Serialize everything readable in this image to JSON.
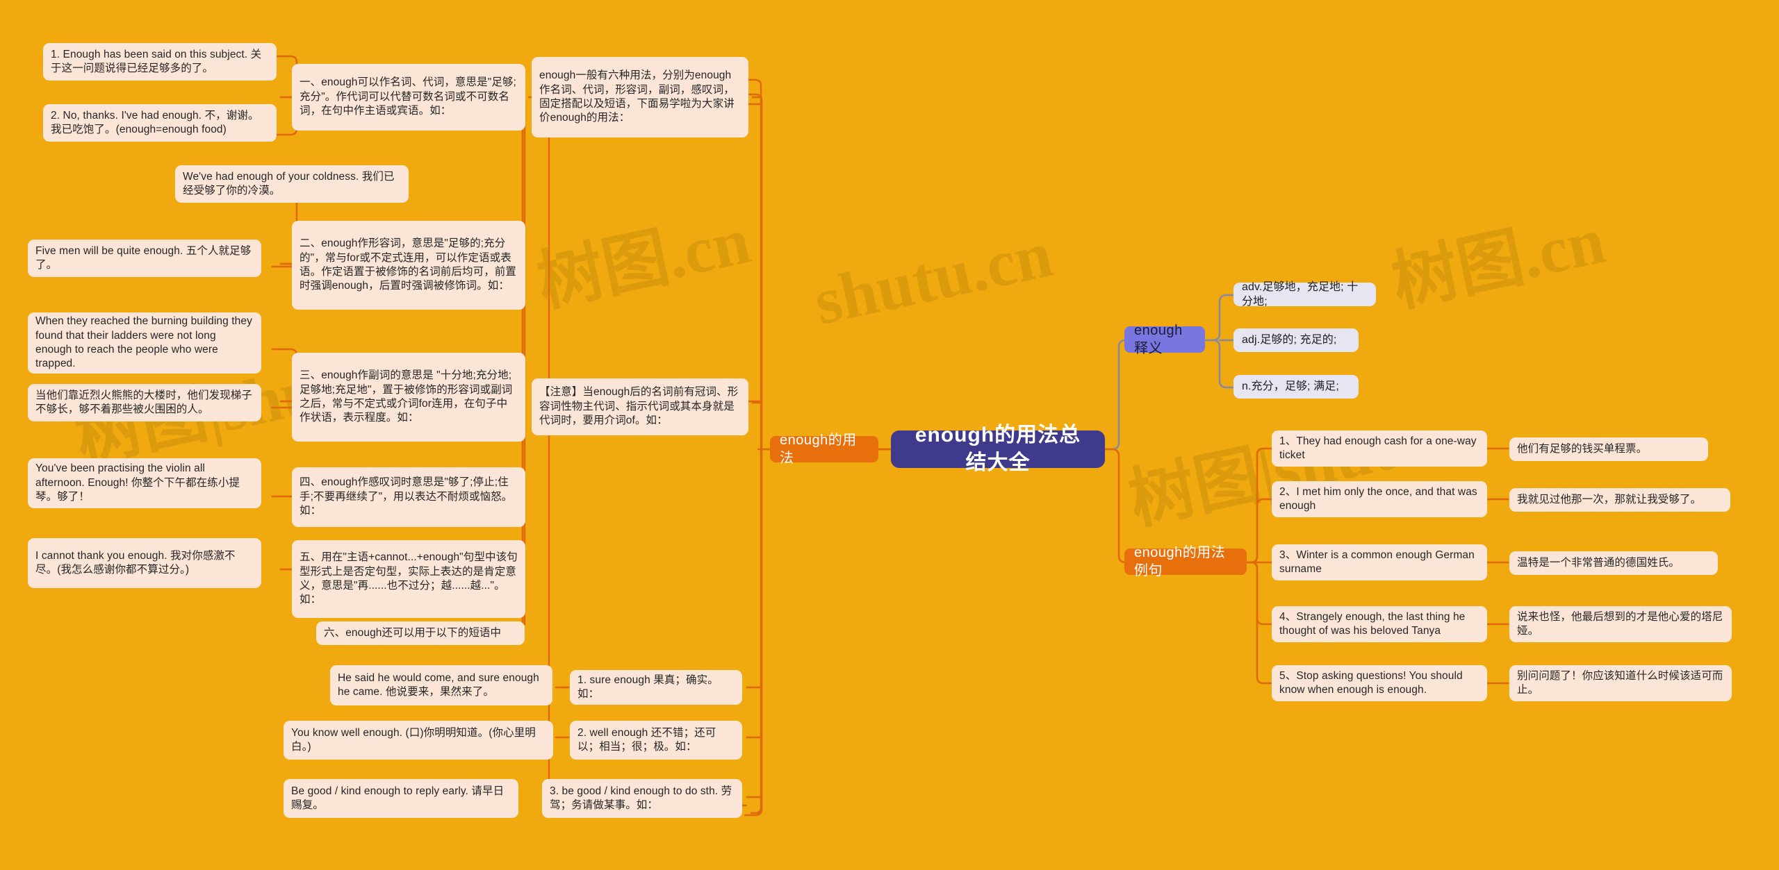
{
  "root": {
    "label": "enough的用法总结大全"
  },
  "watermarks": [
    "树图.cn",
    "shutu.cn",
    "树图.cn",
    "树图|shu",
    "树图|shutu"
  ],
  "branches": {
    "usage": {
      "label": "enough的用法"
    },
    "meaning": {
      "label": "enough释义"
    },
    "examples": {
      "label": "enough的用法例句"
    }
  },
  "intro": {
    "text": "enough一般有六种用法，分别为enough作名词、代词，形容词，副词，感叹词，固定搭配以及短语，下面易学啦为大家讲价enough的用法："
  },
  "note": {
    "text": "【注意】当enough后的名词前有冠词、形容词性物主代词、指示代词或其本身就是代词时，要用介词of。如："
  },
  "rules": [
    {
      "id": "rule1",
      "text": "一、enough可以作名词、代词，意思是\"足够;充分\"。作代词可以代替可数名词或不可数名词，在句中作主语或宾语。如："
    },
    {
      "id": "rule2",
      "text": "二、enough作形容词，意思是\"足够的;充分的\"，常与for或不定式连用，可以作定语或表语。作定语置于被修饰的名词前后均可，前置时强调enough，后置时强调被修饰词。如："
    },
    {
      "id": "rule3",
      "text": "三、enough作副词的意思是 \"十分地;充分地;足够地;充足地\"，置于被修饰的形容词或副词之后，常与不定式或介词for连用，在句子中作状语，表示程度。如："
    },
    {
      "id": "rule4",
      "text": "四、enough作感叹词时意思是\"够了;停止;住手;不要再继续了\"，用以表达不耐烦或恼怒。如："
    },
    {
      "id": "rule5",
      "text": "五、用在\"主语+cannot...+enough\"句型中该句型形式上是否定句型，实际上表达的是肯定意义，意思是\"再......也不过分；越......越...\"。如："
    },
    {
      "id": "rule6",
      "text": "六、enough还可以用于以下的短语中"
    }
  ],
  "rule1_examples": [
    {
      "text": "1. Enough has been said on this subject. 关于这一问题说得已经足够多的了。"
    },
    {
      "text": "2. No, thanks. I've had enough. 不，谢谢。我已吃饱了。(enough=enough food)"
    }
  ],
  "rule2_examples": [
    {
      "text": "We've had enough of your coldness. 我们已经受够了你的冷漠。"
    },
    {
      "text": "Five men will be quite enough. 五个人就足够了。"
    }
  ],
  "rule3_examples": [
    {
      "text": "When they reached the burning building they found that their ladders were not long enough to reach the people who were trapped."
    },
    {
      "text": "当他们靠近烈火熊熊的大楼时，他们发现梯子不够长，够不着那些被火围困的人。"
    }
  ],
  "rule4_examples": [
    {
      "text": "You've been practising the violin all afternoon. Enough! 你整个下午都在练小提琴。够了！"
    }
  ],
  "rule5_examples": [
    {
      "text": "I cannot thank you enough. 我对你感激不尽。(我怎么感谢你都不算过分。)"
    }
  ],
  "phrases": [
    {
      "label": "1. sure enough 果真；确实。如：",
      "example": "He said he would come, and sure enough he came. 他说要来，果然来了。"
    },
    {
      "label": "2. well enough 还不错；还可以；相当；很；极。如：",
      "example": "You know well enough. (口)你明明知道。(你心里明白。)"
    },
    {
      "label": "3. be good / kind enough to do sth. 劳驾；务请做某事。如：",
      "example": "Be good / kind enough to reply early. 请早日赐复。"
    }
  ],
  "meanings": [
    {
      "text": "adv.足够地，充足地; 十分地;"
    },
    {
      "text": "adj.足够的; 充足的;"
    },
    {
      "text": "n.充分，足够; 满足;"
    }
  ],
  "examples": [
    {
      "en": "1、They had enough cash for a one-way ticket",
      "zh": "他们有足够的钱买单程票。"
    },
    {
      "en": "2、I met him only the once, and that was enough",
      "zh": "我就见过他那一次，那就让我受够了。"
    },
    {
      "en": "3、Winter is a common enough German surname",
      "zh": "温特是一个非常普通的德国姓氏。"
    },
    {
      "en": "4、Strangely enough, the last thing he thought of was his beloved Tanya",
      "zh": "说来也怪，他最后想到的才是他心爱的塔尼娅。"
    },
    {
      "en": "5、Stop asking questions! You should know when enough is enough.",
      "zh": "别问问题了！你应该知道什么时候该适可而止。"
    }
  ],
  "colors": {
    "background": "#f0a90e",
    "root_fill": "#403a8c",
    "orange_fill": "#e8700c",
    "purple_fill": "#7a76e0",
    "leaf_fill": "#fbe5d6",
    "def_fill": "#e6e6f2",
    "wire_orange": "#e0690b",
    "wire_gray": "#8a8a9e"
  }
}
